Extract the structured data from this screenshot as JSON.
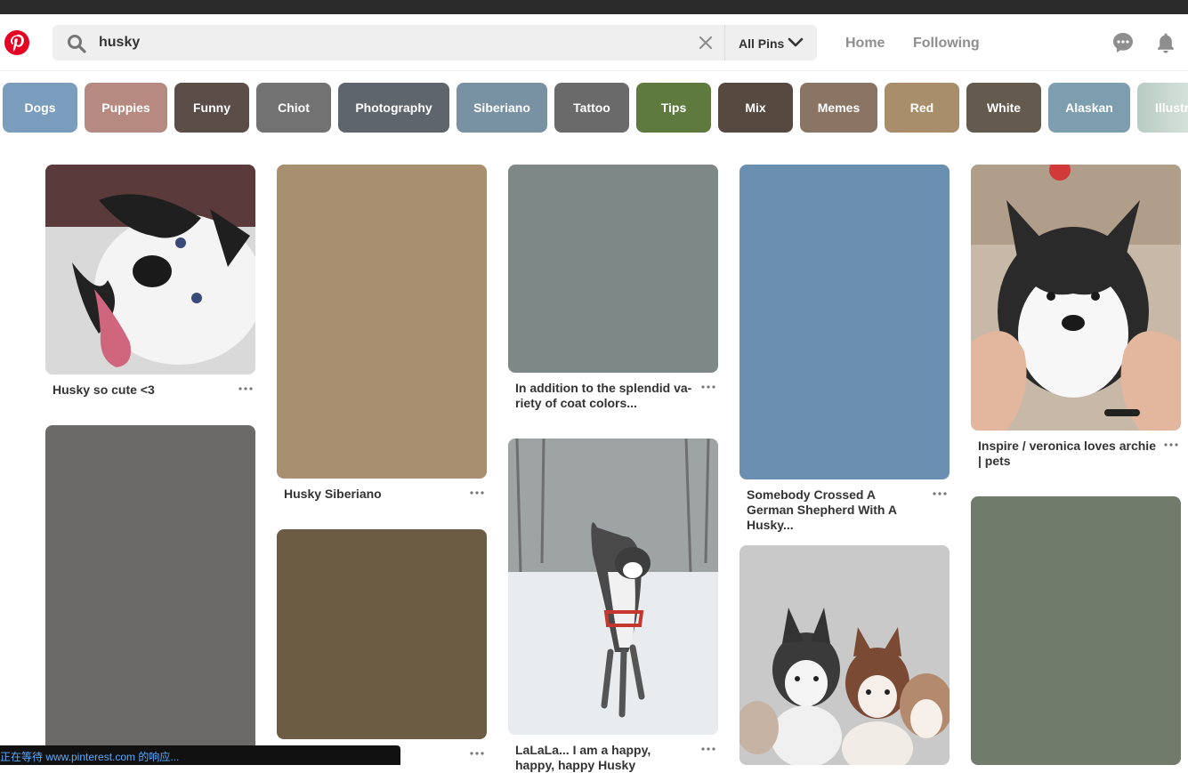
{
  "search": {
    "query": "husky",
    "filter_label": "All Pins"
  },
  "nav": {
    "home": "Home",
    "following": "Following"
  },
  "chips": [
    {
      "label": "Dogs",
      "color": "#7a9cbd"
    },
    {
      "label": "Puppies",
      "color": "#b68a80"
    },
    {
      "label": "Funny",
      "color": "#5b4d48"
    },
    {
      "label": "Chiot",
      "color": "#727272"
    },
    {
      "label": "Photography",
      "color": "#5e656d"
    },
    {
      "label": "Siberiano",
      "color": "#7892a3"
    },
    {
      "label": "Tattoo",
      "color": "#6a6a6a"
    },
    {
      "label": "Tips",
      "color": "#5f7a3e"
    },
    {
      "label": "Mix",
      "color": "#56493f"
    },
    {
      "label": "Memes",
      "color": "#8a7565"
    },
    {
      "label": "Red",
      "color": "#a88e6a"
    },
    {
      "label": "White",
      "color": "#645a4e"
    },
    {
      "label": "Alaskan",
      "color": "#7d9eae"
    },
    {
      "label": "Illustra",
      "color": "#b8cbc2"
    }
  ],
  "pins": {
    "p1": {
      "title": "Husky so cute <3"
    },
    "p2": {
      "title": "Husky Siberiano",
      "color": "#a88f70"
    },
    "p3": {
      "title": "In addition to the splendid va-riety of coat colors...",
      "color": "#7e8886"
    },
    "p4": {
      "title": "Somebody Crossed A German Shepherd With A Husky...",
      "color": "#6a8fb0"
    },
    "p5": {
      "title": "Inspire / veronica loves archie | pets"
    },
    "p6": {
      "color": "#6c6a68"
    },
    "p7": {
      "color": "#6c5c43"
    },
    "p8": {
      "title": "LaLaLa... I am a happy, happy, happy Husky"
    },
    "p10": {
      "color": "#707b6b"
    }
  },
  "status_text": "正在等待 www.pinterest.com 的响应..."
}
